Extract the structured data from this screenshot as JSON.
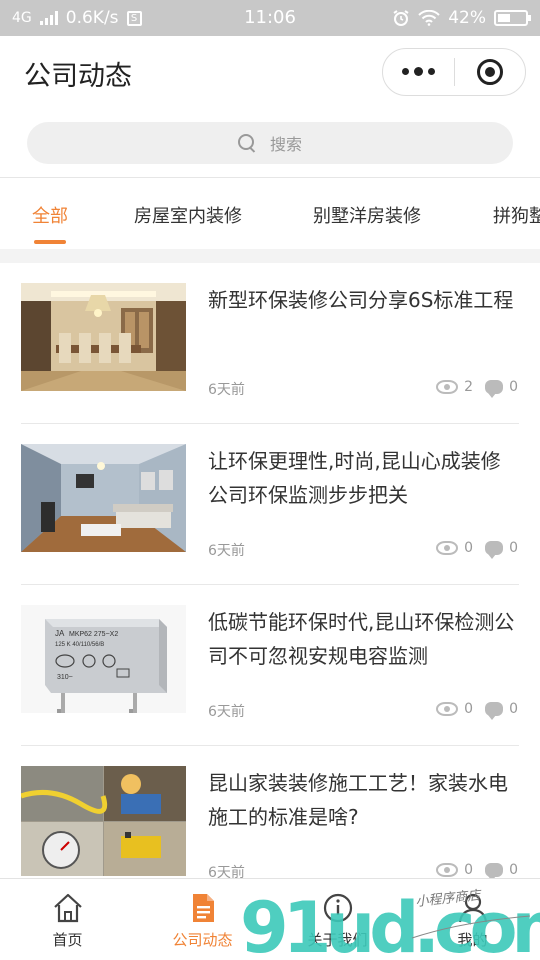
{
  "status_bar": {
    "network": "4G",
    "speed": "0.6K/s",
    "time": "11:06",
    "battery": "42%"
  },
  "header": {
    "title": "公司动态"
  },
  "search": {
    "placeholder": "搜索"
  },
  "tabs": [
    {
      "label": "全部",
      "active": true
    },
    {
      "label": "房屋室内装修",
      "active": false
    },
    {
      "label": "别墅洋房装修",
      "active": false
    },
    {
      "label": "拼狗整",
      "active": false
    }
  ],
  "articles": [
    {
      "title": "新型环保装修公司分享6S标准工程",
      "time": "6天前",
      "views": "2",
      "comments": "0",
      "image": "dining-room-photo"
    },
    {
      "title": "让环保更理性,时尚,昆山心成装修公司环保监测步步把关",
      "time": "6天前",
      "views": "0",
      "comments": "0",
      "image": "living-room-photo"
    },
    {
      "title": "低碳节能环保时代,昆山环保检测公司不可忽视安规电容监测",
      "time": "6天前",
      "views": "0",
      "comments": "0",
      "image": "capacitor-photo",
      "capacitor_text": {
        "brand": "JA",
        "model": "MKP62 275~X2",
        "spec": "125 K 40/110/56/B",
        "marks": "310~"
      }
    },
    {
      "title": "昆山家装装修施工工艺！家装水电施工的标准是啥?",
      "time": "6天前",
      "views": "0",
      "comments": "0",
      "image": "plumbing-photo"
    }
  ],
  "tab_bar": [
    {
      "label": "首页",
      "icon": "home-icon",
      "active": false
    },
    {
      "label": "公司动态",
      "icon": "document-icon",
      "active": true
    },
    {
      "label": "关于我们",
      "icon": "info-icon",
      "active": false
    },
    {
      "label": "我的",
      "icon": "user-icon",
      "active": false
    }
  ],
  "watermark": {
    "text": "91ud.com",
    "handwritten": "小程序商店"
  },
  "colors": {
    "accent": "#f08336",
    "status_bar_bg": "#c8c8c8",
    "watermark_teal": "#3cc9b9",
    "watermark_orange": "#f6a623"
  }
}
